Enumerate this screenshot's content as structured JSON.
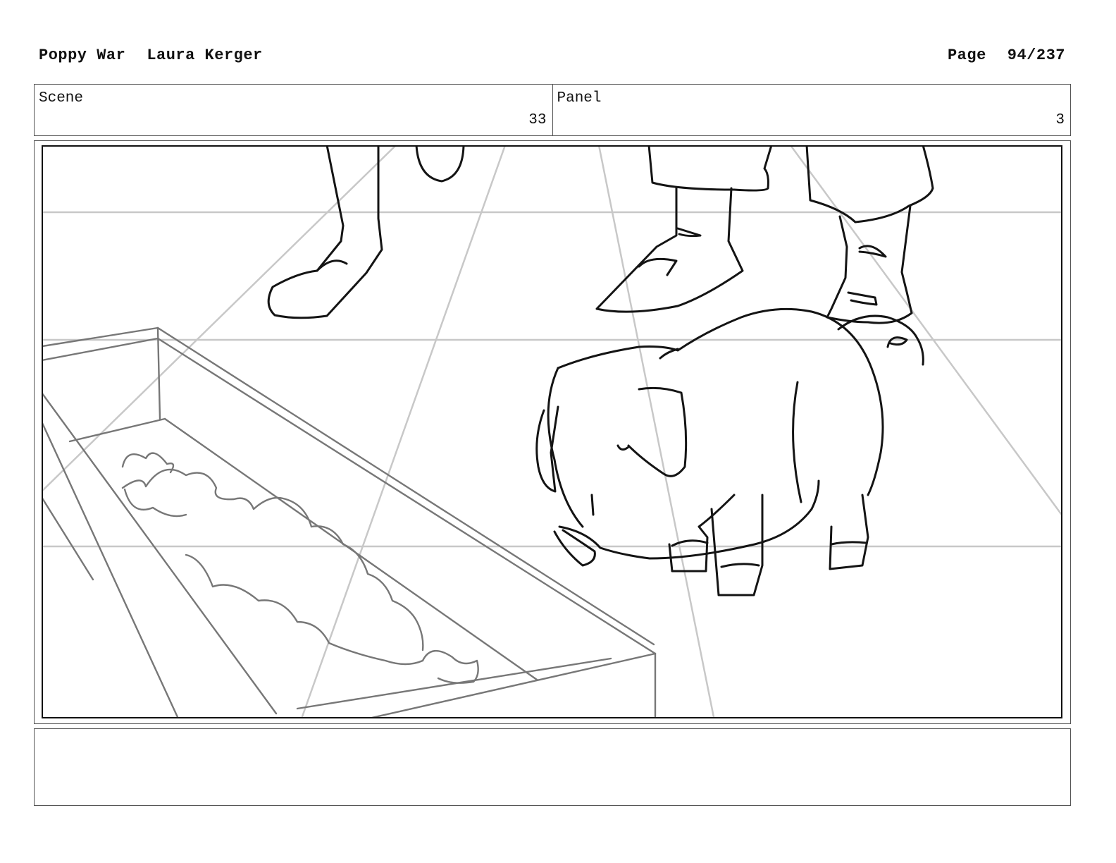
{
  "header": {
    "project_title": "Poppy War",
    "author": "Laura Kerger",
    "page_label": "Page",
    "page_number": "94/237"
  },
  "info": {
    "scene_label": "Scene",
    "scene_value": "33",
    "panel_label": "Panel",
    "panel_value": "3"
  },
  "notes": {
    "text": ""
  }
}
